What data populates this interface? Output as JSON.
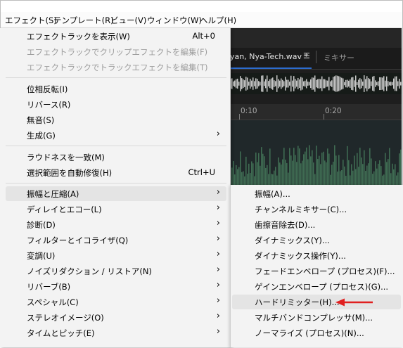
{
  "menubar": {
    "items": [
      "エフェクト(S)",
      "テンプレート(R)",
      "ビュー(V)",
      "ウィンドウ(W)",
      "ヘルプ(H)"
    ]
  },
  "editor": {
    "active_tab": "yan, Nya-Tech.wav *",
    "inactive_tab": "ミキサー",
    "ruler_labels": [
      "0:10",
      "0:20"
    ]
  },
  "effects_menu": {
    "show_rack": {
      "label": "エフェクトラックを表示(W)",
      "shortcut": "Alt+0"
    },
    "edit_clip_rack": "エフェクトラックでクリップエフェクトを編集(F)",
    "edit_track_rack": "エフェクトラックでトラックエフェクトを編集(T)",
    "invert": "位相反転(I)",
    "reverse": "リバース(R)",
    "silence": "無音(S)",
    "generate": "生成(G)",
    "match_loudness": "ラウドネスを一致(M)",
    "auto_heal": {
      "label": "選択範囲を自動修復(H)",
      "shortcut": "Ctrl+U"
    },
    "amplitude": "振幅と圧縮(A)",
    "delay_echo": "ディレイとエコー(L)",
    "diagnostics": "診断(D)",
    "filter_eq": "フィルターとイコライザ(Q)",
    "modulation": "変調(U)",
    "noise_reduction": "ノイズリダクション / リストア(N)",
    "reverb": "リバーブ(B)",
    "special": "スペシャル(C)",
    "stereo_imagery": "ステレオイメージ(O)",
    "time_pitch": "タイムとピッチ(E)"
  },
  "amplitude_submenu": [
    "振幅(A)...",
    "チャンネルミキサー(C)...",
    "歯擦音除去(D)...",
    "ダイナミックス(Y)...",
    "ダイナミックス操作(Y)...",
    "フェードエンベロープ (プロセス)(F)...",
    "ゲインエンベロープ (プロセス)(G)...",
    "ハードリミッター(H)...",
    "マルチバンドコンプレッサ(M)...",
    "ノーマライズ (プロセス)(N)..."
  ],
  "submenu_arrow_glyph": "›",
  "colors": {
    "annotation_arrow": "#e02020",
    "waveform": "#3f6b52"
  }
}
